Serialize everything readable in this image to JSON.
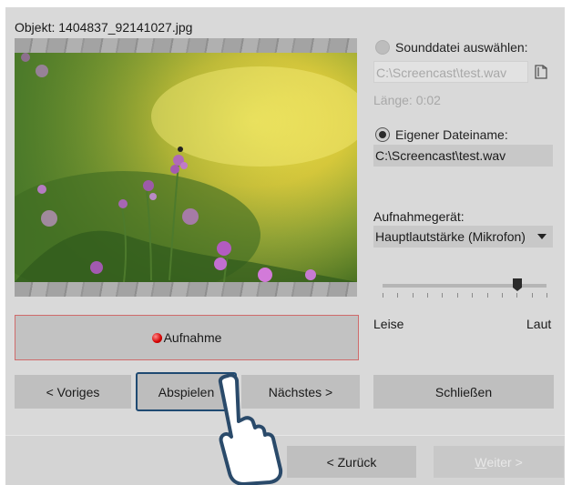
{
  "object_title": "Objekt: 1404837_92141027.jpg",
  "sound_file": {
    "radio_label": "Sounddatei auswählen:",
    "path": "C:\\Screencast\\test.wav",
    "length": "Länge: 0:02",
    "selected": false
  },
  "own_filename": {
    "radio_label": "Eigener Dateiname:",
    "path": "C:\\Screencast\\test.wav",
    "selected": true
  },
  "device": {
    "label": "Aufnahmegerät:",
    "selected_value": "Hauptlautstärke (Mikrofon)"
  },
  "volume": {
    "level": 0.82,
    "min_label": "Leise",
    "max_label": "Laut"
  },
  "record_button": "Aufnahme",
  "nav": {
    "previous": "< Voriges",
    "play": "Abspielen",
    "next": "Nächstes >",
    "close": "Schließen"
  },
  "footer": {
    "back": "< Zurück",
    "forward_underlined": "W",
    "forward_rest": "eiter >"
  },
  "icons": {
    "folder": "folder-icon",
    "dropdown": "chevron-down-icon",
    "record": "record-dot-icon",
    "cursor": "hand-pointer-icon"
  },
  "colors": {
    "dialog_bg": "#d9d9d9",
    "record_border": "#cf6b6b",
    "focus_border": "#1f4a72",
    "disabled_text": "#a8a8a8"
  }
}
